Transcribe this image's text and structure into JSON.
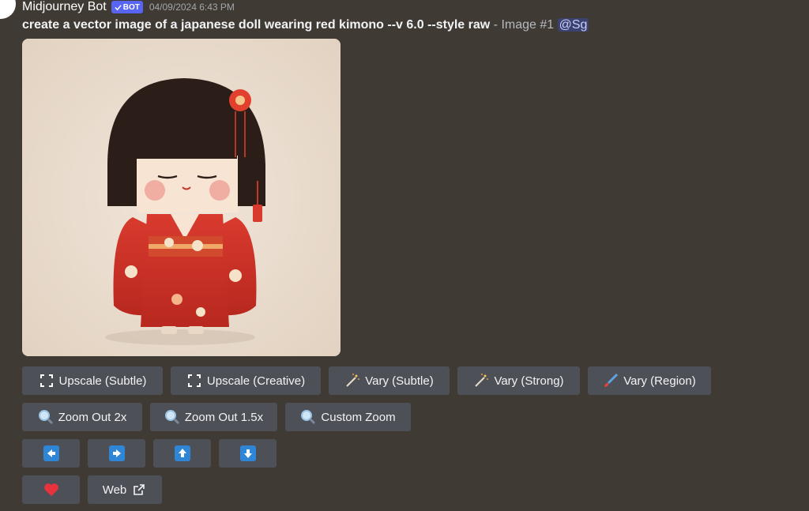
{
  "message": {
    "username": "Midjourney Bot",
    "bot_tag": "BOT",
    "timestamp": "04/09/2024 6:43 PM",
    "prompt": "create a vector image of a japanese doll wearing red kimono --v 6.0 --style raw",
    "suffix": " - Image #1 ",
    "mention": "@Sg"
  },
  "buttons": {
    "row1": [
      "Upscale (Subtle)",
      "Upscale (Creative)",
      "Vary (Subtle)",
      "Vary (Strong)",
      "Vary (Region)"
    ],
    "row2": [
      "Zoom Out 2x",
      "Zoom Out 1.5x",
      "Custom Zoom"
    ],
    "web": "Web"
  },
  "icons": {
    "upscale": "expand-arrows-icon",
    "vary": "magic-wand-icon",
    "region": "paintbrush-icon",
    "zoom": "magnifier-icon",
    "arrows": [
      "arrow-left-icon",
      "arrow-right-icon",
      "arrow-up-icon",
      "arrow-down-icon"
    ],
    "heart": "heart-icon",
    "external": "external-link-icon"
  },
  "colors": {
    "background": "#3f3a33",
    "button": "#4e5058",
    "bot_tag": "#5865f2",
    "arrow_blue": "#2f86d6",
    "heart": "#e8333f"
  }
}
